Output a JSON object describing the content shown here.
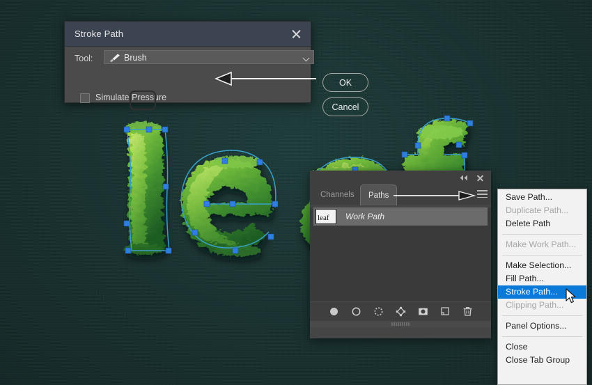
{
  "app": {
    "background_color": "#16302f",
    "artwork_text": "leaf",
    "path_anchor_color": "#2f7fe0",
    "path_line_color": "#3aa0c8"
  },
  "stroke_dialog": {
    "title": "Stroke Path",
    "close_icon": "close-icon",
    "tool_label": "Tool:",
    "tool_value": "Brush",
    "tool_icon": "brush-icon",
    "dropdown_icon": "chevron-down-icon",
    "checkbox_label": "Simulate Pressure",
    "checkbox_checked": false,
    "ok_label": "OK",
    "cancel_label": "Cancel"
  },
  "paths_panel": {
    "collapse_icon": "collapse-double-chevron-icon",
    "close_icon": "close-icon",
    "menu_icon": "hamburger-menu-icon",
    "tabs": [
      {
        "label": "Channels",
        "active": false
      },
      {
        "label": "Paths",
        "active": true
      }
    ],
    "rows": [
      {
        "name": "Work Path",
        "thumbnail": "path-thumbnail"
      }
    ],
    "tools": [
      {
        "name": "fill-path-with-foreground-color-icon"
      },
      {
        "name": "stroke-path-with-brush-icon"
      },
      {
        "name": "load-path-as-selection-icon"
      },
      {
        "name": "make-work-path-from-selection-icon"
      },
      {
        "name": "add-layer-mask-icon"
      },
      {
        "name": "create-new-path-icon"
      },
      {
        "name": "delete-path-icon"
      }
    ],
    "resize_grip": "resize-grip"
  },
  "context_menu": {
    "highlight_color": "#0b79d7",
    "items": [
      {
        "label": "Save Path...",
        "state": "enabled",
        "separator_after": false
      },
      {
        "label": "Duplicate Path...",
        "state": "disabled",
        "separator_after": false
      },
      {
        "label": "Delete Path",
        "state": "enabled",
        "separator_after": true
      },
      {
        "label": "Make Work Path...",
        "state": "disabled",
        "separator_after": true
      },
      {
        "label": "Make Selection...",
        "state": "enabled",
        "separator_after": false
      },
      {
        "label": "Fill Path...",
        "state": "enabled",
        "separator_after": false
      },
      {
        "label": "Stroke Path...",
        "state": "selected",
        "separator_after": false
      },
      {
        "label": "Clipping Path...",
        "state": "disabled",
        "separator_after": true
      },
      {
        "label": "Panel Options...",
        "state": "enabled",
        "separator_after": true
      },
      {
        "label": "Close",
        "state": "enabled",
        "separator_after": false
      },
      {
        "label": "Close Tab Group",
        "state": "enabled",
        "separator_after": false
      }
    ]
  },
  "cursor": {
    "icon": "mouse-pointer-arrow-icon"
  }
}
